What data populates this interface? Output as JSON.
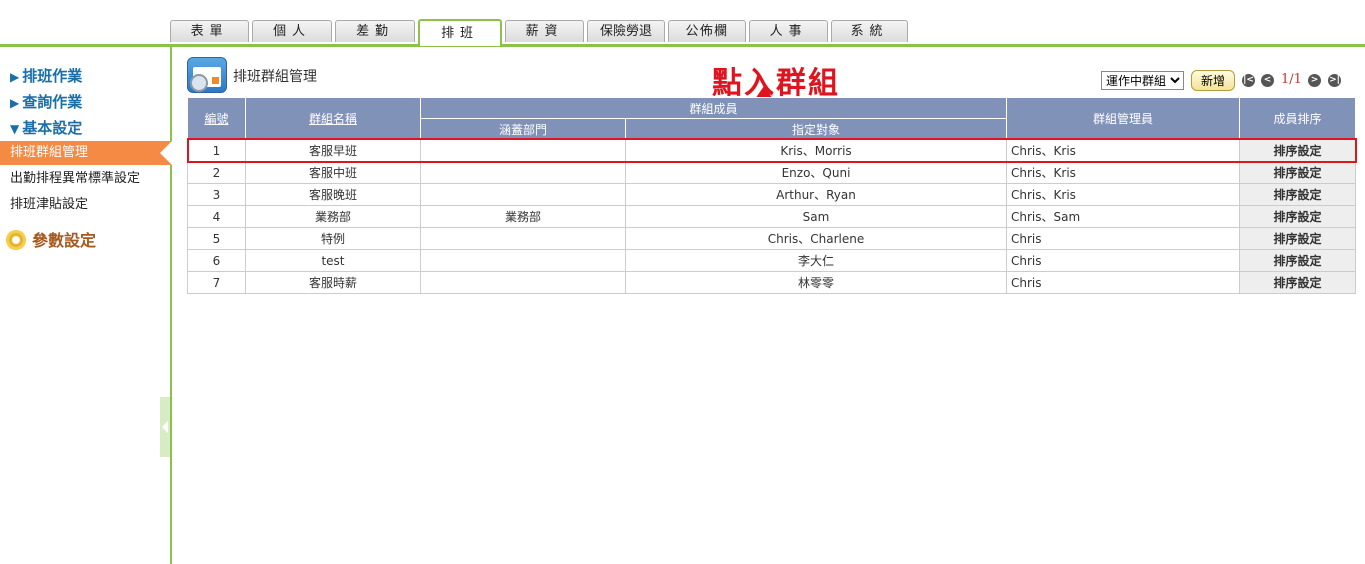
{
  "tabs": [
    {
      "label": "表單",
      "active": false
    },
    {
      "label": "個人",
      "active": false
    },
    {
      "label": "差勤",
      "active": false
    },
    {
      "label": "排班",
      "active": true
    },
    {
      "label": "薪資",
      "active": false
    },
    {
      "label": "保險勞退",
      "active": false
    },
    {
      "label": "公佈欄",
      "active": false
    },
    {
      "label": "人事",
      "active": false
    },
    {
      "label": "系統",
      "active": false
    }
  ],
  "sidebar": {
    "sections": [
      {
        "arrow": "▶",
        "label": "排班作業"
      },
      {
        "arrow": "▶",
        "label": "查詢作業"
      },
      {
        "arrow": "▼",
        "label": "基本設定"
      }
    ],
    "items": [
      {
        "label": "排班群組管理",
        "active": true
      },
      {
        "label": "出勤排程異常標準設定",
        "active": false
      },
      {
        "label": "排班津貼設定",
        "active": false
      }
    ],
    "params_label": "參數設定"
  },
  "page": {
    "title": "排班群組管理",
    "annotation": "點入群組",
    "status_select": "運作中群組",
    "add_button": "新增",
    "pager": {
      "first": "|<",
      "prev": "<",
      "page": "1/1",
      "next": ">",
      "last": ">|"
    }
  },
  "table": {
    "headers": {
      "no": "編號",
      "name": "群組名稱",
      "members": "群組成員",
      "dept": "涵蓋部門",
      "target": "指定對象",
      "managers": "群組管理員",
      "order": "成員排序"
    },
    "rows": [
      {
        "no": "1",
        "name": "客服早班",
        "dept": "",
        "target": "Kris、Morris",
        "managers": "Chris、Kris",
        "action": "排序設定"
      },
      {
        "no": "2",
        "name": "客服中班",
        "dept": "",
        "target": "Enzo、Quni",
        "managers": "Chris、Kris",
        "action": "排序設定"
      },
      {
        "no": "3",
        "name": "客服晚班",
        "dept": "",
        "target": "Arthur、Ryan",
        "managers": "Chris、Kris",
        "action": "排序設定"
      },
      {
        "no": "4",
        "name": "業務部",
        "dept": "業務部",
        "target": "Sam",
        "managers": "Chris、Sam",
        "action": "排序設定"
      },
      {
        "no": "5",
        "name": "特例",
        "dept": "",
        "target": "Chris、Charlene",
        "managers": "Chris",
        "action": "排序設定"
      },
      {
        "no": "6",
        "name": "test",
        "dept": "",
        "target": "李大仁",
        "managers": "Chris",
        "action": "排序設定"
      },
      {
        "no": "7",
        "name": "客服時薪",
        "dept": "",
        "target": "林零零",
        "managers": "Chris",
        "action": "排序設定"
      }
    ]
  }
}
